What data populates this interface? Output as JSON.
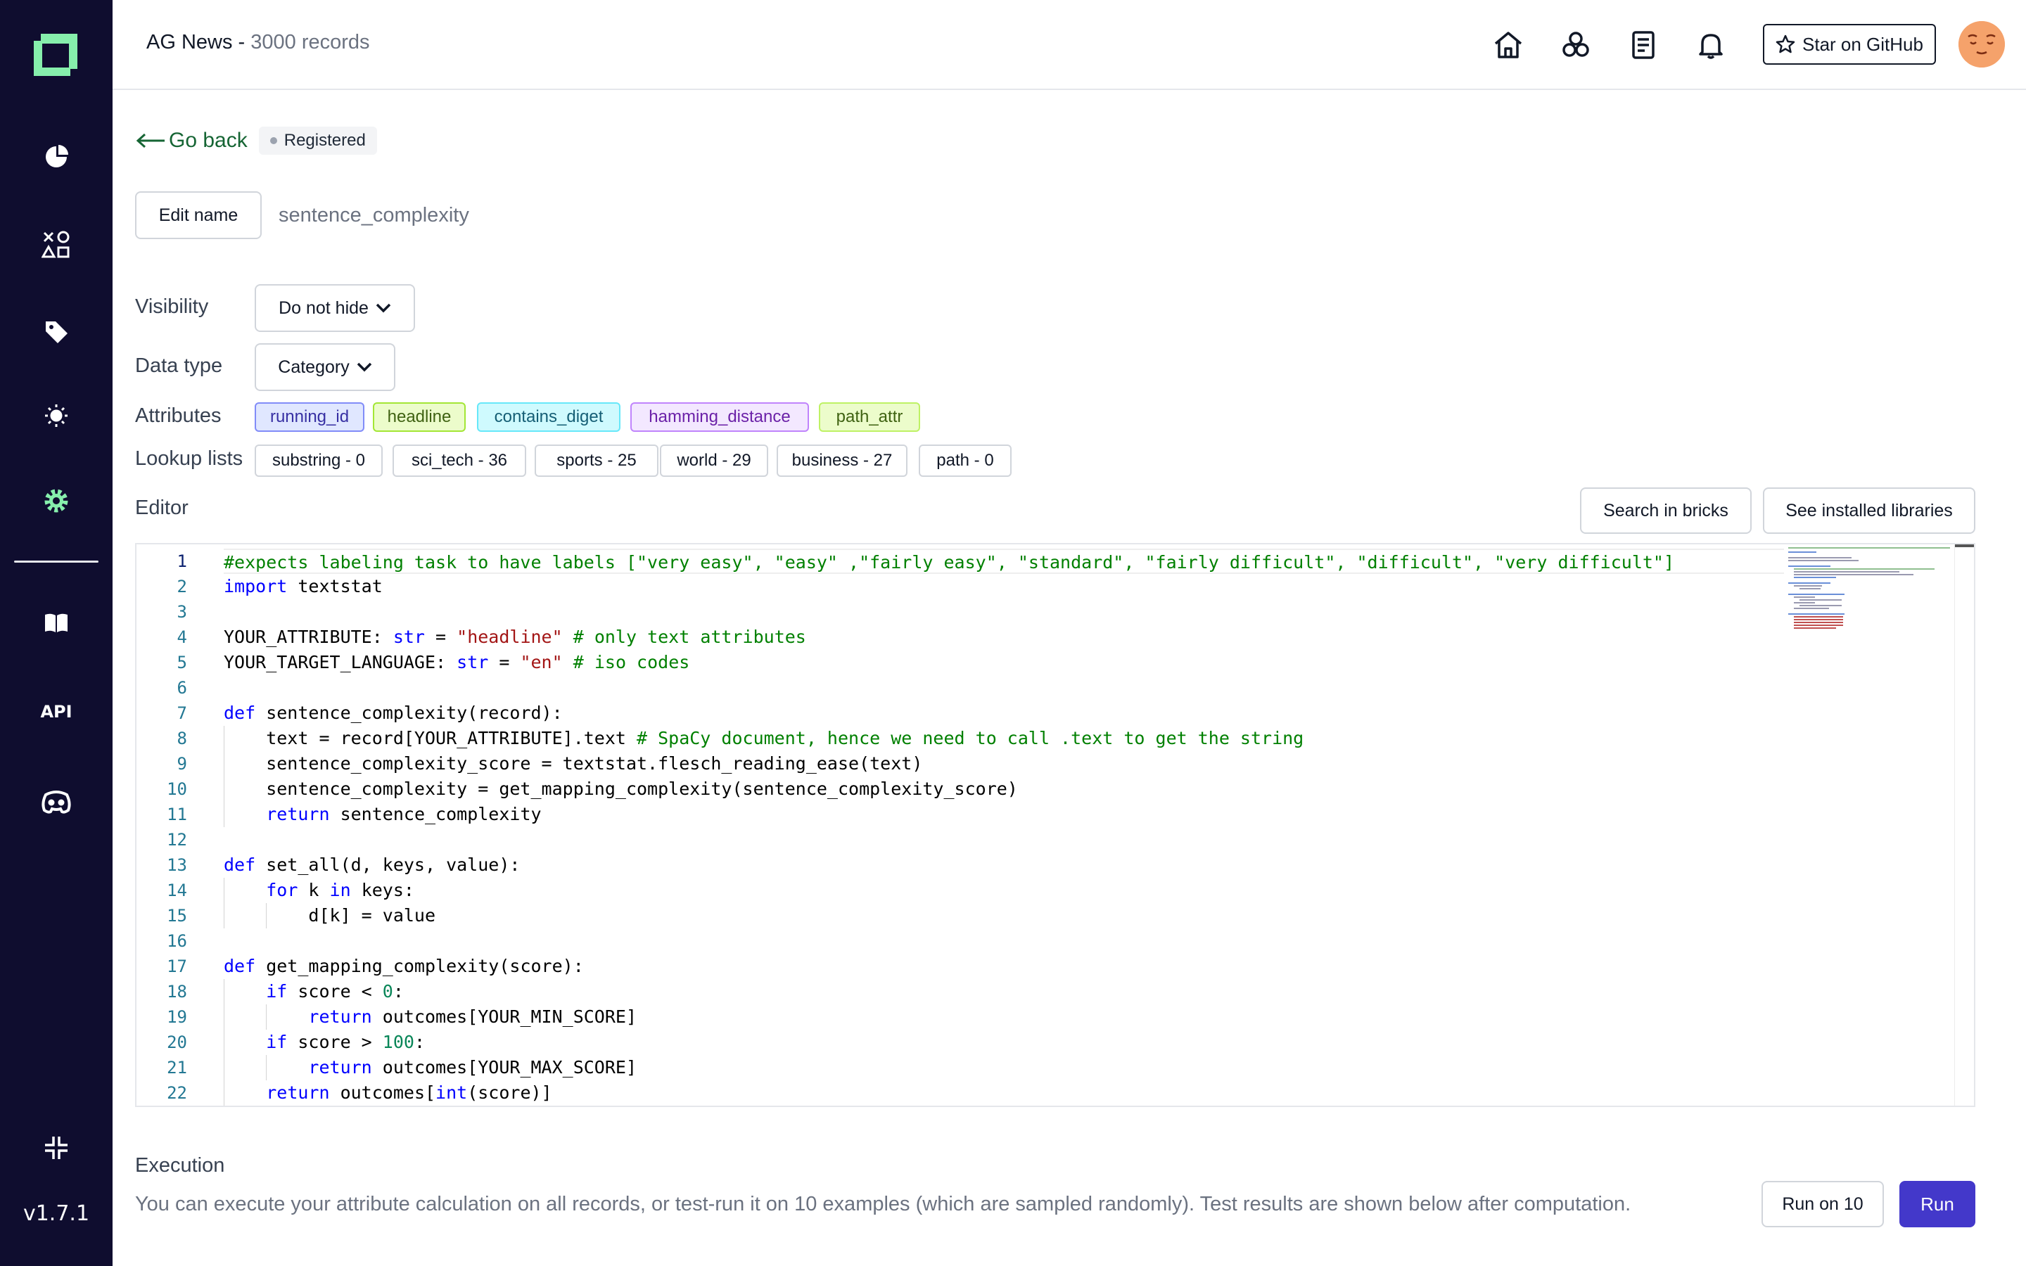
{
  "app": {
    "version": "v1.7.1"
  },
  "header": {
    "project_name": "AG News",
    "separator": " - ",
    "record_count": "3000 records",
    "github_label": "Star on GitHub"
  },
  "icons": {
    "logo": "logo-icon",
    "sidebar": [
      "pie-chart-icon",
      "shapes-icon",
      "tag-icon",
      "bulb-icon",
      "gear-icon",
      "book-icon",
      "api-icon",
      "discord-icon",
      "collapse-icon"
    ],
    "header": [
      "home-icon",
      "hub-icon",
      "document-icon",
      "bell-icon",
      "star-icon"
    ]
  },
  "sidebar": {
    "api_label": "API"
  },
  "nav": {
    "back_label": "Go back",
    "status": "Registered"
  },
  "attribute": {
    "edit_name_label": "Edit name",
    "name": "sentence_complexity",
    "visibility_label": "Visibility",
    "visibility_value": "Do not hide",
    "data_type_label": "Data type",
    "data_type_value": "Category",
    "attributes_label": "Attributes",
    "attributes": [
      {
        "name": "running_id",
        "bg": "#e0e7ff",
        "border": "#818cf8",
        "color": "#3730a3"
      },
      {
        "name": "headline",
        "bg": "#ecfccb",
        "border": "#a3e635",
        "color": "#3f6212"
      },
      {
        "name": "contains_diget",
        "bg": "#cffafe",
        "border": "#67e8f9",
        "color": "#155e75"
      },
      {
        "name": "hamming_distance",
        "bg": "#f3e8ff",
        "border": "#c084fc",
        "color": "#6b21a8"
      },
      {
        "name": "path_attr",
        "bg": "#ecfccb",
        "border": "#bef264",
        "color": "#3f6212"
      }
    ],
    "lookup_label": "Lookup lists",
    "lookup_lists": [
      "substring - 0",
      "sci_tech - 36",
      "sports - 25",
      "world - 29",
      "business - 27",
      "path - 0"
    ]
  },
  "editor": {
    "label": "Editor",
    "search_bricks": "Search in bricks",
    "installed_libs": "See installed libraries",
    "line_numbers": [
      "1",
      "2",
      "3",
      "4",
      "5",
      "6",
      "7",
      "8",
      "9",
      "10",
      "11",
      "12",
      "13",
      "14",
      "15",
      "16",
      "17",
      "18",
      "19",
      "20",
      "21",
      "22"
    ]
  },
  "execution": {
    "title": "Execution",
    "description": "You can execute your attribute calculation on all records, or test-run it on 10 examples (which are sampled randomly). Test results are shown below after computation.",
    "run_on_10": "Run on 10",
    "run": "Run"
  },
  "colors": {
    "sidebar_bg": "#0f0d2f",
    "accent_green": "#86efac",
    "run_button": "#4338ca",
    "back_link": "#166534"
  }
}
